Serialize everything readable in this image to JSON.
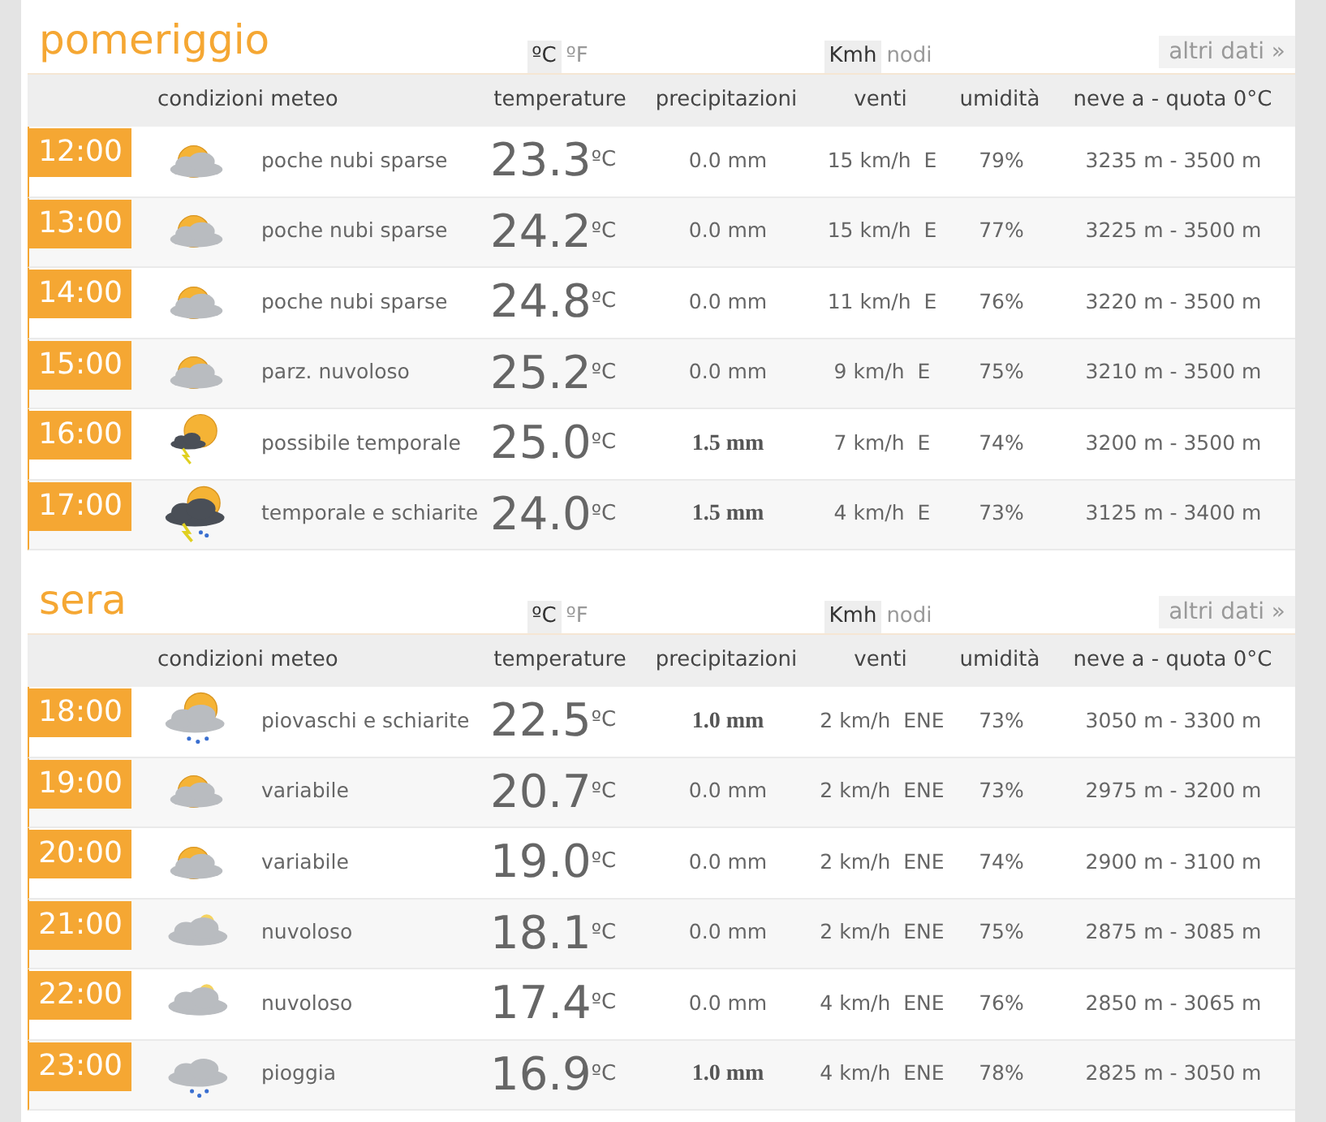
{
  "sections": [
    {
      "title": "pomeriggio",
      "units_temp": [
        {
          "label": "ºC",
          "selected": true
        },
        {
          "label": "ºF",
          "selected": false
        }
      ],
      "units_wind": [
        {
          "label": "Kmh",
          "selected": true
        },
        {
          "label": "nodi",
          "selected": false
        }
      ],
      "more_link": "altri dati »",
      "columns": [
        "condizioni meteo",
        "temperature",
        "precipitazioni",
        "venti",
        "umidità",
        "neve a - quota 0°C"
      ],
      "rows": [
        {
          "time": "12:00",
          "kind": "sun_cloud",
          "condition": "poche nubi sparse",
          "temp": "23.3",
          "temp_unit": "ºC",
          "precip": "0.0 mm",
          "precip_bold": false,
          "wind": "15 km/h",
          "dir": "E",
          "humidity": "79%",
          "snow": "3235 m - 3500 m"
        },
        {
          "time": "13:00",
          "kind": "sun_cloud",
          "condition": "poche nubi sparse",
          "temp": "24.2",
          "temp_unit": "ºC",
          "precip": "0.0 mm",
          "precip_bold": false,
          "wind": "15 km/h",
          "dir": "E",
          "humidity": "77%",
          "snow": "3225 m - 3500 m"
        },
        {
          "time": "14:00",
          "kind": "sun_cloud",
          "condition": "poche nubi sparse",
          "temp": "24.8",
          "temp_unit": "ºC",
          "precip": "0.0 mm",
          "precip_bold": false,
          "wind": "11 km/h",
          "dir": "E",
          "humidity": "76%",
          "snow": "3220 m - 3500 m"
        },
        {
          "time": "15:00",
          "kind": "sun_cloud",
          "condition": "parz. nuvoloso",
          "temp": "25.2",
          "temp_unit": "ºC",
          "precip": "0.0 mm",
          "precip_bold": false,
          "wind": "9 km/h",
          "dir": "E",
          "humidity": "75%",
          "snow": "3210 m - 3500 m"
        },
        {
          "time": "16:00",
          "kind": "storm_sun",
          "condition": "possibile temporale",
          "temp": "25.0",
          "temp_unit": "ºC",
          "precip": "1.5 mm",
          "precip_bold": true,
          "wind": "7 km/h",
          "dir": "E",
          "humidity": "74%",
          "snow": "3200 m - 3500 m"
        },
        {
          "time": "17:00",
          "kind": "storm",
          "condition": "temporale e schiarite",
          "temp": "24.0",
          "temp_unit": "ºC",
          "precip": "1.5 mm",
          "precip_bold": true,
          "wind": "4 km/h",
          "dir": "E",
          "humidity": "73%",
          "snow": "3125 m - 3400 m"
        }
      ]
    },
    {
      "title": "sera",
      "units_temp": [
        {
          "label": "ºC",
          "selected": true
        },
        {
          "label": "ºF",
          "selected": false
        }
      ],
      "units_wind": [
        {
          "label": "Kmh",
          "selected": true
        },
        {
          "label": "nodi",
          "selected": false
        }
      ],
      "more_link": "altri dati »",
      "columns": [
        "condizioni meteo",
        "temperature",
        "precipitazioni",
        "venti",
        "umidità",
        "neve a - quota 0°C"
      ],
      "rows": [
        {
          "time": "18:00",
          "kind": "rain_sun",
          "condition": "piovaschi e schiarite",
          "temp": "22.5",
          "temp_unit": "ºC",
          "precip": "1.0 mm",
          "precip_bold": true,
          "wind": "2 km/h",
          "dir": "ENE",
          "humidity": "73%",
          "snow": "3050 m - 3300 m"
        },
        {
          "time": "19:00",
          "kind": "sun_cloud",
          "condition": "variabile",
          "temp": "20.7",
          "temp_unit": "ºC",
          "precip": "0.0 mm",
          "precip_bold": false,
          "wind": "2 km/h",
          "dir": "ENE",
          "humidity": "73%",
          "snow": "2975 m - 3200 m"
        },
        {
          "time": "20:00",
          "kind": "sun_cloud",
          "condition": "variabile",
          "temp": "19.0",
          "temp_unit": "ºC",
          "precip": "0.0 mm",
          "precip_bold": false,
          "wind": "2 km/h",
          "dir": "ENE",
          "humidity": "74%",
          "snow": "2900 m - 3100 m"
        },
        {
          "time": "21:00",
          "kind": "cloud",
          "condition": "nuvoloso",
          "temp": "18.1",
          "temp_unit": "ºC",
          "precip": "0.0 mm",
          "precip_bold": false,
          "wind": "2 km/h",
          "dir": "ENE",
          "humidity": "75%",
          "snow": "2875 m - 3085 m"
        },
        {
          "time": "22:00",
          "kind": "cloud",
          "condition": "nuvoloso",
          "temp": "17.4",
          "temp_unit": "ºC",
          "precip": "0.0 mm",
          "precip_bold": false,
          "wind": "4 km/h",
          "dir": "ENE",
          "humidity": "76%",
          "snow": "2850 m - 3065 m"
        },
        {
          "time": "23:00",
          "kind": "rain",
          "condition": "pioggia",
          "temp": "16.9",
          "temp_unit": "ºC",
          "precip": "1.0 mm",
          "precip_bold": true,
          "wind": "4 km/h",
          "dir": "ENE",
          "humidity": "78%",
          "snow": "2825 m - 3050 m"
        }
      ]
    }
  ]
}
